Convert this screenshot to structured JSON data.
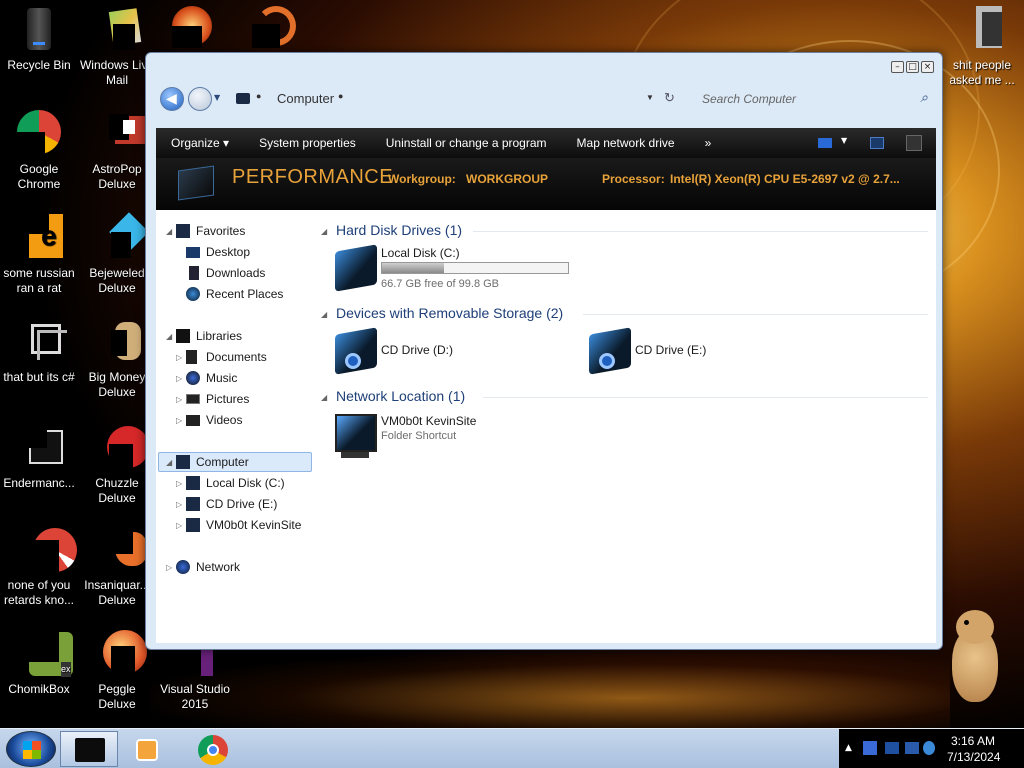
{
  "desktop": {
    "icons": [
      {
        "label": "Recycle Bin"
      },
      {
        "label": "Windows Live Mail"
      },
      {
        "label": "Google Chrome"
      },
      {
        "label": "AstroPop Deluxe"
      },
      {
        "label": "some russian ran a rat"
      },
      {
        "label": "Bejeweled Deluxe"
      },
      {
        "label": "that but its c#"
      },
      {
        "label": "Big Money Deluxe"
      },
      {
        "label": "Endermanc..."
      },
      {
        "label": "Chuzzle Deluxe"
      },
      {
        "label": "none of you retards kno..."
      },
      {
        "label": "Insaniquar... Deluxe"
      },
      {
        "label": "ChomikBox"
      },
      {
        "label": "Peggle Deluxe"
      },
      {
        "label": "Visual Studio 2015"
      },
      {
        "label": "shit people asked me ..."
      }
    ]
  },
  "window": {
    "address": {
      "location": "Computer"
    },
    "search": {
      "placeholder": "Search Computer"
    },
    "toolbar": {
      "organize": "Organize",
      "system_properties": "System properties",
      "uninstall": "Uninstall or change a program",
      "map_drive": "Map network drive",
      "more": "»"
    },
    "details": {
      "title": "PERFORMANCE",
      "workgroup_label": "Workgroup:",
      "workgroup_value": "WORKGROUP",
      "processor_label": "Processor:",
      "processor_value": "Intel(R) Xeon(R) CPU E5-2697 v2 @ 2.7..."
    },
    "nav": {
      "favorites": "Favorites",
      "desktop": "Desktop",
      "downloads": "Downloads",
      "recent": "Recent Places",
      "libraries": "Libraries",
      "documents": "Documents",
      "music": "Music",
      "pictures": "Pictures",
      "videos": "Videos",
      "computer": "Computer",
      "local_disk": "Local Disk (C:)",
      "cd_drive": "CD Drive (E:)",
      "kevinsite": "VM0b0t KevinSite",
      "network": "Network"
    },
    "groups": {
      "hdd": "Hard Disk Drives (1)",
      "removable": "Devices with Removable Storage (2)",
      "network": "Network Location (1)"
    },
    "drives": {
      "c_name": "Local Disk (C:)",
      "c_free": "66.7 GB free of 99.8 GB",
      "c_used_fraction": 0.332,
      "d_name": "CD Drive (D:)",
      "e_name": "CD Drive (E:)",
      "net_name": "VM0b0t KevinSite",
      "net_sub": "Folder Shortcut"
    }
  },
  "taskbar": {
    "time": "3:16 AM",
    "date": "7/13/2024"
  },
  "colors": {
    "group_header": "#1e3f78",
    "toolbar_bg": "#1a1a1a",
    "perf_accent": "#e8a23a"
  }
}
